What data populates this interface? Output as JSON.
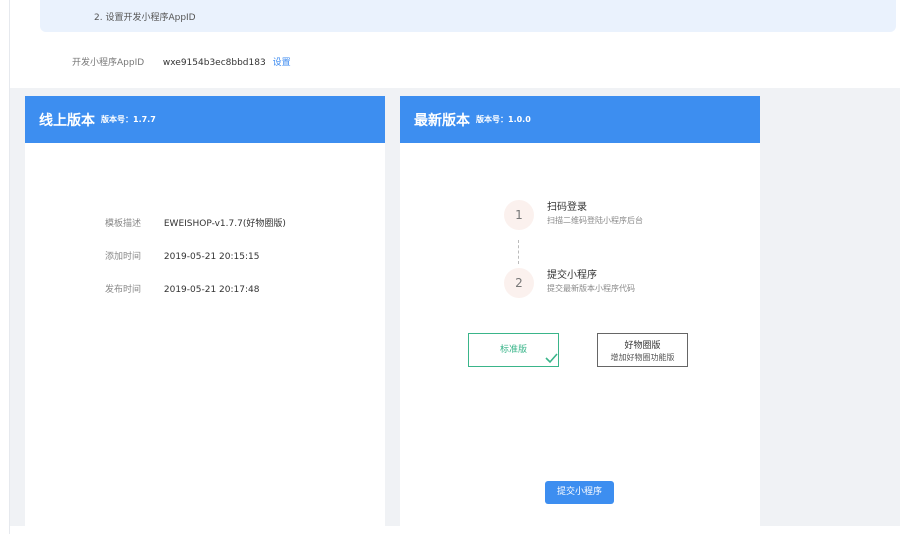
{
  "notice": {
    "text": "2. 设置开发小程序AppID"
  },
  "appid": {
    "label": "开发小程序AppID",
    "value": "wxe9154b3ec8bbd183",
    "link": "设置"
  },
  "online": {
    "title": "线上版本",
    "version": "版本号：1.7.7",
    "rows": [
      {
        "key": "模板描述",
        "value": "EWEISHOP-v1.7.7(好物圈版)"
      },
      {
        "key": "添加时间",
        "value": "2019-05-21 20:15:15"
      },
      {
        "key": "发布时间",
        "value": "2019-05-21 20:17:48"
      }
    ]
  },
  "latest": {
    "title": "最新版本",
    "version": "版本号：1.0.0",
    "steps": [
      {
        "num": "1",
        "title": "扫码登录",
        "desc": "扫描二维码登陆小程序后台"
      },
      {
        "num": "2",
        "title": "提交小程序",
        "desc": "提交最新版本小程序代码"
      }
    ],
    "options": {
      "standard": "标准版",
      "good_title": "好物圈版",
      "good_desc": "增加好物圈功能版"
    },
    "submit": "提交小程序"
  },
  "colors": {
    "accent": "#3d8ef0",
    "selected": "#3ab58a",
    "notice_bg": "#eaf2fd",
    "page_bg": "#f0f2f5"
  }
}
